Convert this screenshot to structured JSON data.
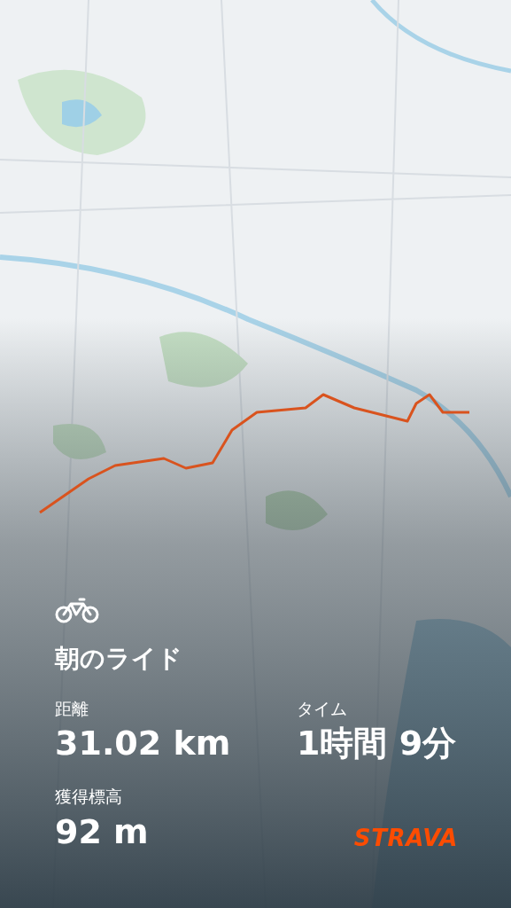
{
  "activity": {
    "title": "朝のライド",
    "stats": [
      {
        "label": "距離",
        "value": "31.02 km"
      },
      {
        "label": "タイム",
        "value": "1時間 9分"
      },
      {
        "label": "獲得標高",
        "value": "92 m"
      }
    ]
  },
  "brand": "STRAVA"
}
